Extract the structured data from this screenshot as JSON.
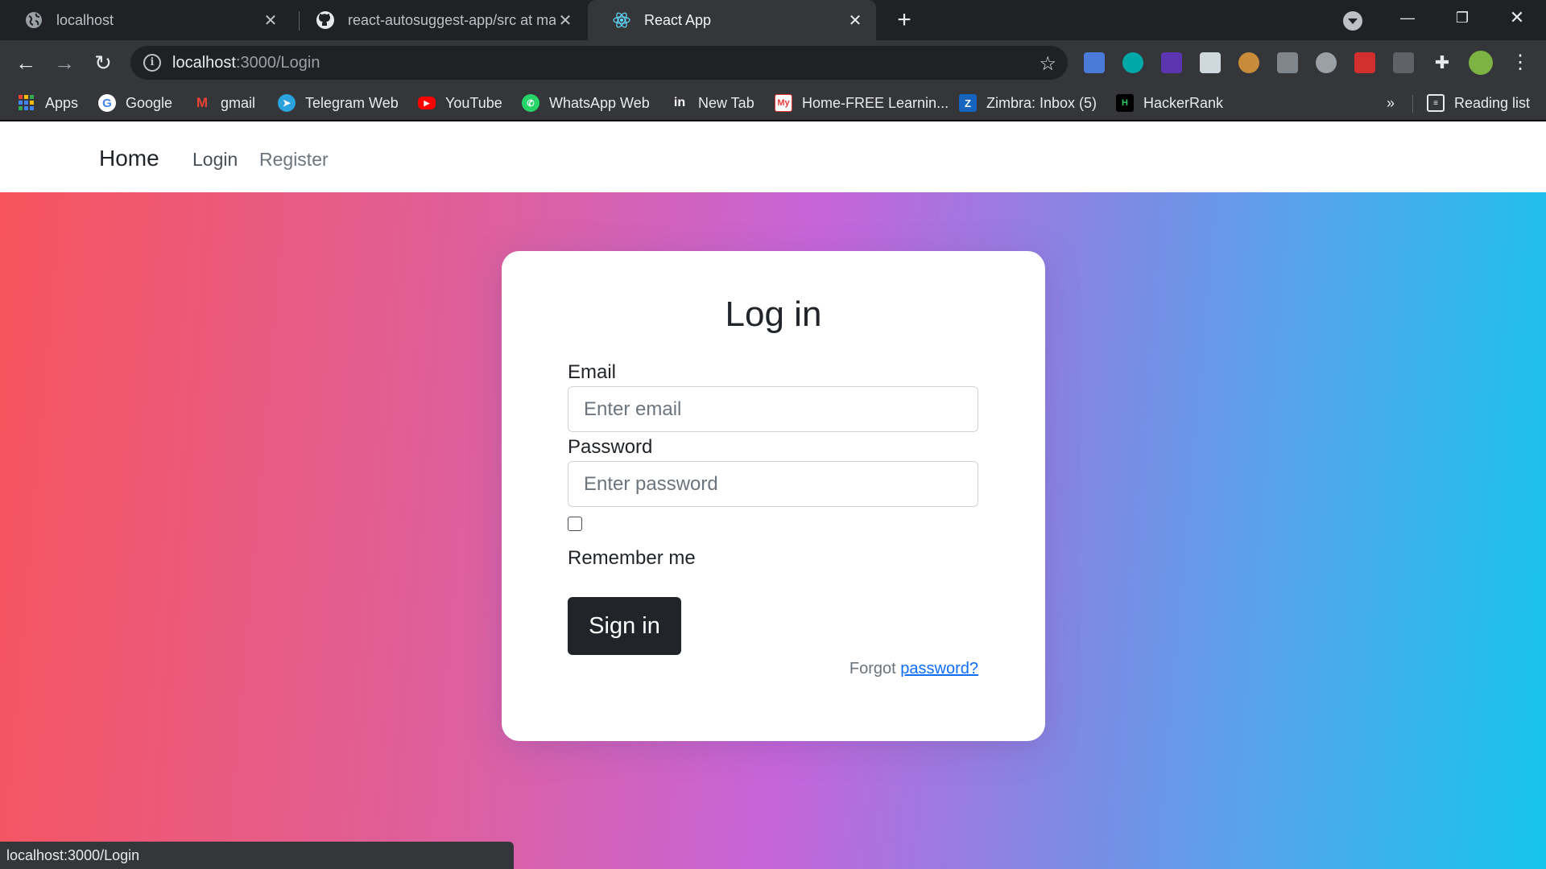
{
  "tabs": [
    {
      "title": "localhost",
      "icon": "globe-icon"
    },
    {
      "title": "react-autosuggest-app/src at ma",
      "icon": "github-icon"
    },
    {
      "title": "React App",
      "icon": "react-icon"
    }
  ],
  "toolbar": {
    "url_host": "localhost",
    "url_path": ":3000/Login"
  },
  "bookmarks": [
    {
      "label": "Apps",
      "icon": "apps-grid-icon",
      "color": "#ea4335"
    },
    {
      "label": "Google",
      "icon": "google-icon",
      "color": "#4285f4"
    },
    {
      "label": "gmail",
      "icon": "gmail-icon",
      "color": "#ea4335"
    },
    {
      "label": "Telegram Web",
      "icon": "telegram-icon",
      "color": "#2aa3df"
    },
    {
      "label": "YouTube",
      "icon": "youtube-icon",
      "color": "#ff0000"
    },
    {
      "label": "WhatsApp Web",
      "icon": "whatsapp-icon",
      "color": "#25d366"
    },
    {
      "label": "New Tab",
      "icon": "linkedin-icon",
      "color": "#0a66c2"
    },
    {
      "label": "Home-FREE Learnin...",
      "icon": "my-icon",
      "color": "#e53935"
    },
    {
      "label": "Zimbra: Inbox (5)",
      "icon": "zimbra-icon",
      "color": "#1565c0"
    },
    {
      "label": "HackerRank",
      "icon": "hackerrank-icon",
      "color": "#000000"
    }
  ],
  "reading_list": "Reading list",
  "navbar": {
    "brand": "Home",
    "links": [
      "Login",
      "Register"
    ]
  },
  "login": {
    "title": "Log in",
    "email_label": "Email",
    "email_placeholder": "Enter email",
    "password_label": "Password",
    "password_placeholder": "Enter password",
    "remember_label": "Remember me",
    "submit_label": "Sign in",
    "forgot_text": "Forgot",
    "forgot_link": "password?"
  },
  "status_bar": "localhost:3000/Login",
  "colors": {
    "submit_bg": "#212529",
    "link": "#0d6efd",
    "gradient_start": "#f7545c",
    "gradient_end": "#15c5ea"
  }
}
